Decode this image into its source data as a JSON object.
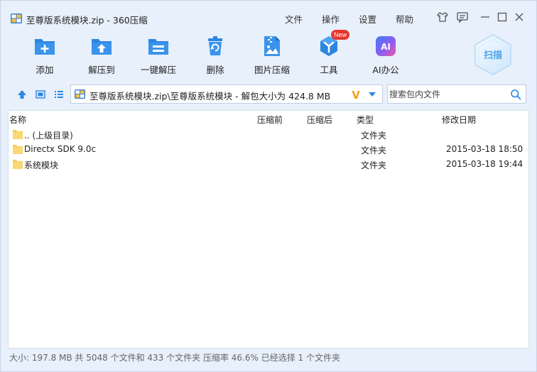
{
  "window": {
    "title": "至尊版系统模块.zip - 360压缩",
    "menu": [
      "文件",
      "操作",
      "设置",
      "帮助"
    ]
  },
  "toolbar": {
    "buttons": [
      {
        "label": "添加",
        "icon": "add-icon"
      },
      {
        "label": "解压到",
        "icon": "extract-to-icon"
      },
      {
        "label": "一键解压",
        "icon": "one-click-extract-icon"
      },
      {
        "label": "删除",
        "icon": "delete-icon"
      },
      {
        "label": "图片压缩",
        "icon": "image-compress-icon"
      },
      {
        "label": "工具",
        "icon": "tools-icon"
      },
      {
        "label": "AI办公",
        "icon": "ai-office-icon"
      }
    ],
    "new_badge": "New",
    "ai_text": "AI",
    "scan_label": "扫描"
  },
  "address": {
    "path": "至尊版系统模块.zip\\至尊版系统模块 - 解包大小为 424.8 MB",
    "v_text": "V"
  },
  "search": {
    "placeholder": "搜索包内文件"
  },
  "columns": {
    "name": "名称",
    "packed_before": "压缩前",
    "packed_after": "压缩后",
    "type": "类型",
    "modified": "修改日期"
  },
  "files": [
    {
      "name": ".. (上级目录)",
      "type": "文件夹",
      "date": ""
    },
    {
      "name": "Directx SDK 9.0c",
      "type": "文件夹",
      "date": "2015-03-18 18:50"
    },
    {
      "name": "系统模块",
      "type": "文件夹",
      "date": "2015-03-18 19:44"
    }
  ],
  "status": {
    "text": "大小: 197.8 MB 共 5048 个文件和 433 个文件夹 压缩率 46.6% 已经选择 1 个文件夹"
  },
  "colors": {
    "accent": "#2b86e2",
    "window_bg": "#e7f0fb",
    "folder": "#f5cd5a",
    "badge": "#e8342c"
  }
}
